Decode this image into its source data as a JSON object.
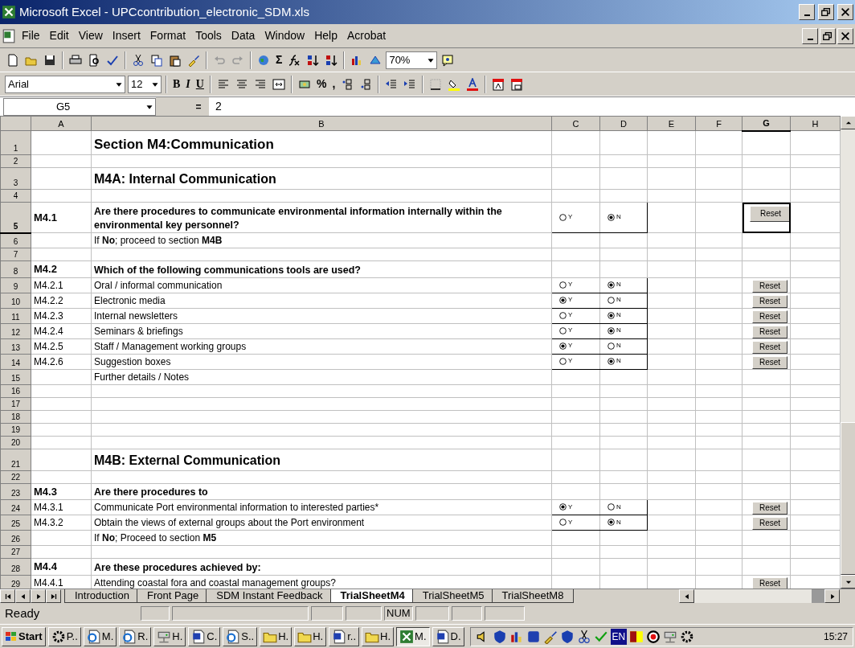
{
  "window": {
    "title": "Microsoft Excel - UPCcontribution_electronic_SDM.xls"
  },
  "menu": [
    "File",
    "Edit",
    "View",
    "Insert",
    "Format",
    "Tools",
    "Data",
    "Window",
    "Help",
    "Acrobat"
  ],
  "standard_toolbar": {
    "sum": "Σ",
    "zoom": "70%"
  },
  "formatting_toolbar": {
    "font": "Arial",
    "size": "12",
    "bold": "B",
    "italic": "I",
    "underline": "U",
    "percent": "%",
    "comma": ","
  },
  "formula_bar": {
    "name_box": "G5",
    "equals": "=",
    "value": "2"
  },
  "columns": [
    {
      "label": "A",
      "selected": false
    },
    {
      "label": "B",
      "selected": false
    },
    {
      "label": "C",
      "selected": false
    },
    {
      "label": "D",
      "selected": false
    },
    {
      "label": "E",
      "selected": false
    },
    {
      "label": "F",
      "selected": false
    },
    {
      "label": "G",
      "selected": true
    },
    {
      "label": "H",
      "selected": false
    }
  ],
  "rows": [
    {
      "num": "1",
      "kind": "title",
      "b": "Section M4:Communication",
      "selected": false
    },
    {
      "num": "2",
      "kind": "blank",
      "selected": false
    },
    {
      "num": "3",
      "kind": "heading",
      "b": "M4A: Internal Communication",
      "selected": false
    },
    {
      "num": "4",
      "kind": "blank",
      "selected": false
    },
    {
      "num": "5",
      "kind": "question",
      "a": "M4.1",
      "b": "Are there procedures to communicate environmental information internally within the environmental key personnel?",
      "options": [
        {
          "label": "Y",
          "selected": false
        },
        {
          "label": "N",
          "selected": true
        }
      ],
      "reset": "Reset",
      "selected": true
    },
    {
      "num": "6",
      "kind": "note",
      "b": "If **No**; proceed to section **M4B**",
      "selected": false
    },
    {
      "num": "7",
      "kind": "blank",
      "selected": false
    },
    {
      "num": "8",
      "kind": "question",
      "a": "M4.2",
      "b": "Which of the following communications tools are used?",
      "selected": false
    },
    {
      "num": "9",
      "kind": "item",
      "a": "M4.2.1",
      "b": "Oral / informal communication",
      "options": [
        {
          "label": "Y",
          "selected": false
        },
        {
          "label": "N",
          "selected": true
        }
      ],
      "reset": "Reset",
      "selected": false
    },
    {
      "num": "10",
      "kind": "item",
      "a": "M4.2.2",
      "b": "Electronic media",
      "options": [
        {
          "label": "Y",
          "selected": true
        },
        {
          "label": "N",
          "selected": false
        }
      ],
      "reset": "Reset",
      "selected": false
    },
    {
      "num": "11",
      "kind": "item",
      "a": "M4.2.3",
      "b": "Internal newsletters",
      "options": [
        {
          "label": "Y",
          "selected": false
        },
        {
          "label": "N",
          "selected": true
        }
      ],
      "reset": "Reset",
      "selected": false
    },
    {
      "num": "12",
      "kind": "item",
      "a": "M4.2.4",
      "b": "Seminars & briefings",
      "options": [
        {
          "label": "Y",
          "selected": false
        },
        {
          "label": "N",
          "selected": true
        }
      ],
      "reset": "Reset",
      "selected": false
    },
    {
      "num": "13",
      "kind": "item",
      "a": "M4.2.5",
      "b": "Staff / Management working groups",
      "options": [
        {
          "label": "Y",
          "selected": true
        },
        {
          "label": "N",
          "selected": false
        }
      ],
      "reset": "Reset",
      "selected": false
    },
    {
      "num": "14",
      "kind": "item",
      "a": "M4.2.6",
      "b": "Suggestion boxes",
      "options": [
        {
          "label": "Y",
          "selected": false
        },
        {
          "label": "N",
          "selected": true
        }
      ],
      "reset": "Reset",
      "selected": false
    },
    {
      "num": "15",
      "kind": "note",
      "b": "Further details / Notes",
      "selected": false
    },
    {
      "num": "16",
      "kind": "blank",
      "selected": false
    },
    {
      "num": "17",
      "kind": "blank",
      "selected": false
    },
    {
      "num": "18",
      "kind": "blank",
      "selected": false
    },
    {
      "num": "19",
      "kind": "blank",
      "selected": false
    },
    {
      "num": "20",
      "kind": "blank",
      "selected": false
    },
    {
      "num": "21",
      "kind": "heading",
      "b": "M4B: External Communication",
      "selected": false
    },
    {
      "num": "22",
      "kind": "blank",
      "selected": false
    },
    {
      "num": "23",
      "kind": "question",
      "a": "M4.3",
      "b": "Are there procedures to",
      "selected": false
    },
    {
      "num": "24",
      "kind": "item",
      "a": "M4.3.1",
      "b": "Communicate Port environmental information to interested parties*",
      "options": [
        {
          "label": "Y",
          "selected": true
        },
        {
          "label": "N",
          "selected": false
        }
      ],
      "reset": "Reset",
      "selected": false
    },
    {
      "num": "25",
      "kind": "item",
      "a": "M4.3.2",
      "b": "Obtain the views of external groups about the Port environment",
      "options": [
        {
          "label": "Y",
          "selected": false
        },
        {
          "label": "N",
          "selected": true
        }
      ],
      "reset": "Reset",
      "selected": false
    },
    {
      "num": "26",
      "kind": "note",
      "b": "If **No**; Proceed to section **M5**",
      "selected": false
    },
    {
      "num": "27",
      "kind": "blank",
      "selected": false
    },
    {
      "num": "28",
      "kind": "question",
      "a": "M4.4",
      "b": "Are these procedures achieved by:",
      "selected": false
    },
    {
      "num": "29",
      "kind": "item",
      "a": "M4.4.1",
      "b": "Attending coastal fora and coastal management groups?",
      "reset": "Reset",
      "selected": false
    }
  ],
  "sheet_tabs": [
    {
      "label": "Introduction",
      "selected": false
    },
    {
      "label": "Front Page",
      "selected": false
    },
    {
      "label": "SDM Instant Feedback",
      "selected": false
    },
    {
      "label": "TrialSheetM4",
      "selected": true
    },
    {
      "label": "TrialSheetM5",
      "selected": false
    },
    {
      "label": "TrialSheetM8",
      "selected": false
    }
  ],
  "status_bar": {
    "mode": "Ready",
    "num_indicator": "NUM"
  },
  "taskbar": {
    "start": "Start",
    "buttons": [
      {
        "label": "P..",
        "selected": false
      },
      {
        "label": "M.",
        "selected": false
      },
      {
        "label": "R.",
        "selected": false
      },
      {
        "label": "H.",
        "selected": false
      },
      {
        "label": "C.",
        "selected": false
      },
      {
        "label": "S..",
        "selected": false
      },
      {
        "label": "H.",
        "selected": false
      },
      {
        "label": "H.",
        "selected": false
      },
      {
        "label": "r..",
        "selected": false
      },
      {
        "label": "H.",
        "selected": false
      },
      {
        "label": "M.",
        "selected": true
      },
      {
        "label": "D.",
        "selected": false
      }
    ],
    "language": "EN",
    "clock": "15:27"
  }
}
